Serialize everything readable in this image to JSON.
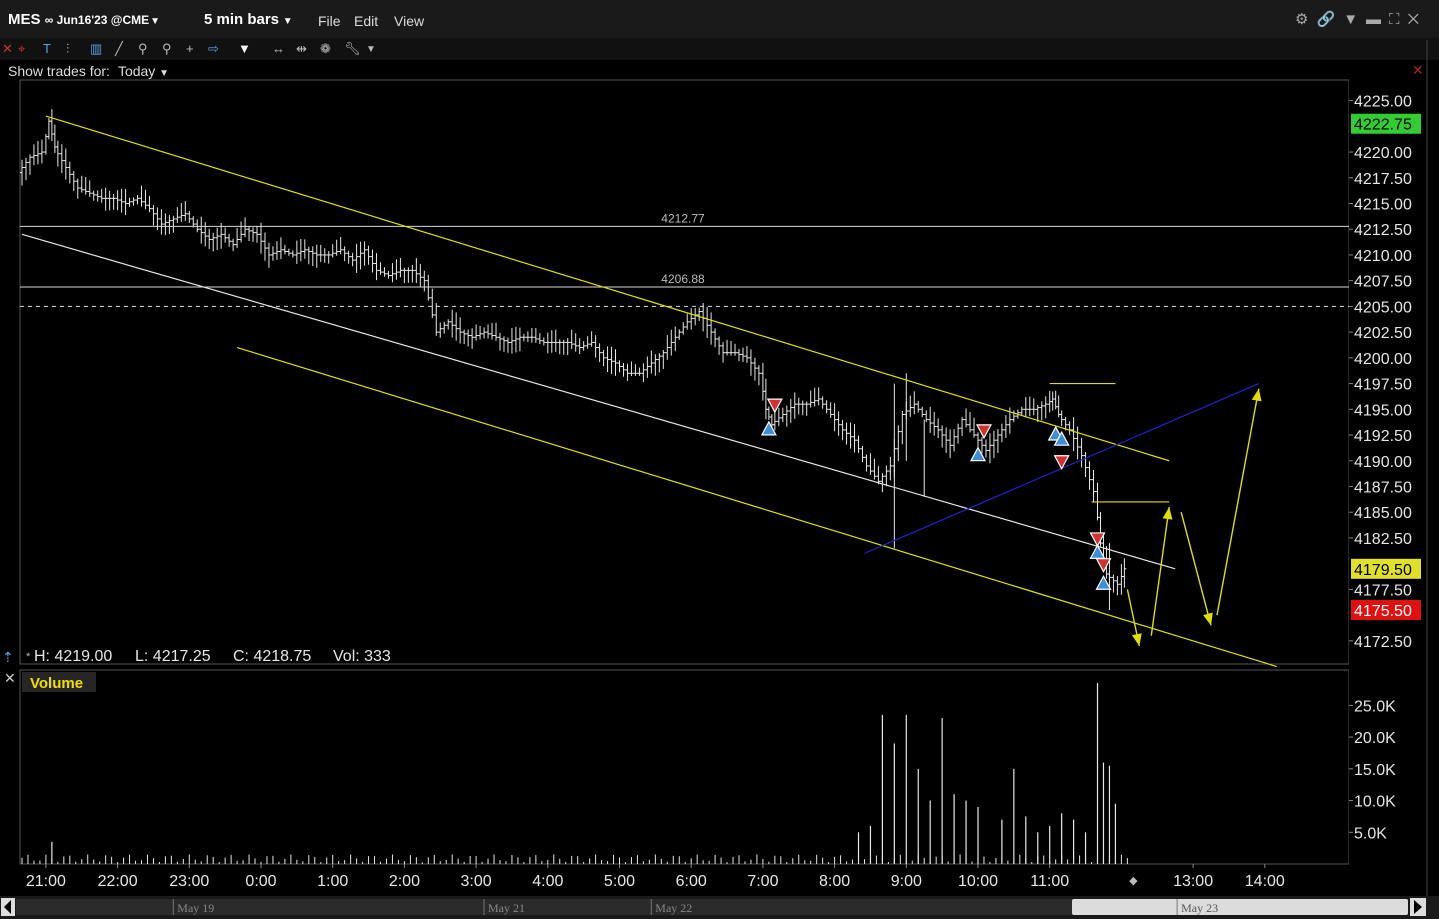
{
  "header": {
    "symbol": "MES",
    "contract": "∞ Jun16'23 @CME",
    "bar_size": "5 min bars",
    "menus": [
      "File",
      "Edit",
      "View"
    ]
  },
  "show_trades": {
    "label": "Show trades for:",
    "value": "Today"
  },
  "ohlc_readout": {
    "h": "H: 4219.00",
    "l": "L: 4217.25",
    "c": "C: 4218.75",
    "vol": "Vol: 333"
  },
  "volume_panel": {
    "label": "Volume"
  },
  "colors": {
    "up_arrow": "#3b8fd9",
    "down_arrow": "#d43030",
    "channel": "#e0e000",
    "mid_line": "#e6e6e6",
    "blue_line": "#2222cc",
    "last_price_bg": "#e0e02a",
    "high_badge_bg": "#33cc33",
    "low_badge_bg": "#e01010"
  },
  "chart_data": {
    "type": "ohlc",
    "price_axis": {
      "range": [
        4170.25,
        4227.0
      ],
      "ticks": [
        "4225.00",
        "4220.00",
        "4217.50",
        "4215.00",
        "4212.50",
        "4210.00",
        "4207.50",
        "4205.00",
        "4202.50",
        "4200.00",
        "4197.50",
        "4195.00",
        "4192.50",
        "4190.00",
        "4187.50",
        "4185.00",
        "4182.50",
        "4177.50",
        "4172.50"
      ]
    },
    "price_badges": [
      {
        "label": "4222.75",
        "value": 4222.75,
        "color": "#33cc33",
        "text_color": "#000"
      },
      {
        "label": "4179.50",
        "value": 4179.5,
        "color": "#e0e02a",
        "text_color": "#000"
      },
      {
        "label": "4175.50",
        "value": 4175.5,
        "color": "#e01010",
        "text_color": "#fff"
      }
    ],
    "h_levels": [
      {
        "value": 4212.77,
        "label": "4212.77",
        "style": "solid"
      },
      {
        "value": 4206.88,
        "label": "4206.88",
        "style": "solid"
      },
      {
        "value": 4205.0,
        "label": "",
        "style": "dashed"
      }
    ],
    "time_axis": {
      "start": "20:40",
      "end": "14:35",
      "ticks": [
        "21:00",
        "22:00",
        "23:00",
        "0:00",
        "1:00",
        "2:00",
        "3:00",
        "4:00",
        "5:00",
        "6:00",
        "7:00",
        "8:00",
        "9:00",
        "10:00",
        "11:00",
        "13:00",
        "14:00"
      ],
      "dates": [
        {
          "label": "May 19",
          "time": "23:00"
        },
        {
          "label": "May 21",
          "time": "3:20"
        },
        {
          "label": "May 22",
          "time": "5:40"
        },
        {
          "label": "May 23",
          "time": "13:00"
        }
      ]
    },
    "bar_points": [
      [
        "20:40",
        4218.0
      ],
      [
        "20:50",
        4219.5
      ],
      [
        "21:00",
        4220.0
      ],
      [
        "21:05",
        4223.0
      ],
      [
        "21:10",
        4220.5
      ],
      [
        "21:20",
        4218.5
      ],
      [
        "21:30",
        4216.5
      ],
      [
        "21:40",
        4216.0
      ],
      [
        "21:50",
        4215.5
      ],
      [
        "22:00",
        4215.5
      ],
      [
        "22:10",
        4215.0
      ],
      [
        "22:20",
        4215.5
      ],
      [
        "22:30",
        4214.5
      ],
      [
        "22:40",
        4213.0
      ],
      [
        "22:50",
        4213.5
      ],
      [
        "23:00",
        4214.0
      ],
      [
        "23:10",
        4212.5
      ],
      [
        "23:20",
        4211.5
      ],
      [
        "23:30",
        4212.0
      ],
      [
        "23:40",
        4211.0
      ],
      [
        "23:50",
        4212.5
      ],
      [
        "0:00",
        4212.0
      ],
      [
        "0:10",
        4210.0
      ],
      [
        "0:20",
        4210.5
      ],
      [
        "0:30",
        4210.0
      ],
      [
        "0:40",
        4210.5
      ],
      [
        "0:50",
        4210.0
      ],
      [
        "1:00",
        4210.0
      ],
      [
        "1:10",
        4210.5
      ],
      [
        "1:20",
        4209.5
      ],
      [
        "1:30",
        4210.5
      ],
      [
        "1:40",
        4208.5
      ],
      [
        "1:50",
        4208.0
      ],
      [
        "2:00",
        4208.5
      ],
      [
        "2:10",
        4208.5
      ],
      [
        "2:20",
        4207.5
      ],
      [
        "2:30",
        4202.5
      ],
      [
        "2:40",
        4203.5
      ],
      [
        "2:50",
        4202.5
      ],
      [
        "3:00",
        4202.0
      ],
      [
        "3:10",
        4202.5
      ],
      [
        "3:20",
        4202.0
      ],
      [
        "3:30",
        4201.5
      ],
      [
        "3:40",
        4202.0
      ],
      [
        "3:50",
        4202.0
      ],
      [
        "4:00",
        4201.5
      ],
      [
        "4:10",
        4201.5
      ],
      [
        "4:20",
        4201.5
      ],
      [
        "4:30",
        4201.0
      ],
      [
        "4:40",
        4201.5
      ],
      [
        "4:50",
        4200.0
      ],
      [
        "5:00",
        4199.5
      ],
      [
        "5:10",
        4198.5
      ],
      [
        "5:20",
        4198.5
      ],
      [
        "5:30",
        4199.5
      ],
      [
        "5:40",
        4200.5
      ],
      [
        "5:50",
        4202.0
      ],
      [
        "6:00",
        4203.5
      ],
      [
        "6:10",
        4204.5
      ],
      [
        "6:20",
        4202.5
      ],
      [
        "6:30",
        4200.5
      ],
      [
        "6:40",
        4200.5
      ],
      [
        "6:50",
        4200.0
      ],
      [
        "7:00",
        4198.5
      ],
      [
        "7:05",
        4195.0
      ],
      [
        "7:10",
        4193.5
      ],
      [
        "7:20",
        4194.5
      ],
      [
        "7:30",
        4195.5
      ],
      [
        "7:40",
        4195.5
      ],
      [
        "7:50",
        4196.0
      ],
      [
        "8:00",
        4194.5
      ],
      [
        "8:10",
        4193.0
      ],
      [
        "8:20",
        4192.0
      ],
      [
        "8:30",
        4189.5
      ],
      [
        "8:40",
        4188.0
      ],
      [
        "8:50",
        4189.5
      ],
      [
        "9:00",
        4194.5
      ],
      [
        "9:10",
        4195.5
      ],
      [
        "9:20",
        4194.0
      ],
      [
        "9:30",
        4193.0
      ],
      [
        "9:40",
        4191.5
      ],
      [
        "9:50",
        4194.0
      ],
      [
        "10:00",
        4192.5
      ],
      [
        "10:10",
        4191.0
      ],
      [
        "10:20",
        4192.5
      ],
      [
        "10:30",
        4194.0
      ],
      [
        "10:40",
        4195.0
      ],
      [
        "10:50",
        4195.0
      ],
      [
        "11:00",
        4195.5
      ],
      [
        "11:05",
        4196.0
      ],
      [
        "11:10",
        4194.5
      ],
      [
        "11:20",
        4193.0
      ],
      [
        "11:30",
        4190.5
      ],
      [
        "11:40",
        4187.0
      ],
      [
        "11:45",
        4182.0
      ],
      [
        "11:50",
        4179.0
      ],
      [
        "12:00",
        4178.0
      ],
      [
        "12:05",
        4179.5
      ]
    ],
    "trade_markers": [
      {
        "side": "sell",
        "time": "7:10",
        "price": 4195.5
      },
      {
        "side": "buy",
        "time": "7:05",
        "price": 4193.0
      },
      {
        "side": "buy",
        "time": "10:00",
        "price": 4190.5
      },
      {
        "side": "sell",
        "time": "10:05",
        "price": 4193.0
      },
      {
        "side": "buy",
        "time": "11:05",
        "price": 4192.5
      },
      {
        "side": "buy",
        "time": "11:10",
        "price": 4192.0
      },
      {
        "side": "sell",
        "time": "11:10",
        "price": 4190.0
      },
      {
        "side": "sell",
        "time": "11:40",
        "price": 4182.5
      },
      {
        "side": "buy",
        "time": "11:40",
        "price": 4181.0
      },
      {
        "side": "sell",
        "time": "11:45",
        "price": 4180.0
      },
      {
        "side": "buy",
        "time": "11:45",
        "price": 4178.0
      }
    ],
    "drawn_lines": [
      {
        "color": "yellow",
        "from": [
          "21:00",
          4223.5
        ],
        "to": [
          "12:40",
          4190.0
        ]
      },
      {
        "color": "yellow",
        "from": [
          "23:40",
          4201.0
        ],
        "to": [
          "14:10",
          4170.0
        ]
      },
      {
        "color": "white",
        "from": [
          "20:40",
          4212.0
        ],
        "to": [
          "12:45",
          4179.5
        ]
      },
      {
        "color": "blue",
        "from": [
          "8:25",
          4181.0
        ],
        "to": [
          "13:55",
          4197.5
        ]
      },
      {
        "color": "yellow",
        "from": [
          "11:00",
          4197.5
        ],
        "to": [
          "11:55",
          4197.5
        ]
      },
      {
        "color": "yellow",
        "from": [
          "11:35",
          4186.0
        ],
        "to": [
          "12:40",
          4186.0
        ]
      }
    ],
    "projection_arrows": [
      {
        "from": [
          "12:05",
          4177.5
        ],
        "to": [
          "12:15",
          4172.0
        ]
      },
      {
        "from": [
          "12:25",
          4173.0
        ],
        "to": [
          "12:40",
          4185.5
        ]
      },
      {
        "from": [
          "12:50",
          4185.0
        ],
        "to": [
          "13:15",
          4174.0
        ]
      },
      {
        "from": [
          "13:20",
          4175.0
        ],
        "to": [
          "13:55",
          4197.0
        ]
      }
    ],
    "volume": {
      "ticks": [
        "25.0K",
        "20.0K",
        "15.0K",
        "10.0K",
        "5.0K"
      ],
      "max": 29000,
      "bars": [
        [
          "21:05",
          3500
        ],
        [
          "8:20",
          5000
        ],
        [
          "8:30",
          6000
        ],
        [
          "8:40",
          23500
        ],
        [
          "8:50",
          19000
        ],
        [
          "9:00",
          23500
        ],
        [
          "9:10",
          15000
        ],
        [
          "9:20",
          10000
        ],
        [
          "9:30",
          23000
        ],
        [
          "9:40",
          11000
        ],
        [
          "9:50",
          10000
        ],
        [
          "10:00",
          9000
        ],
        [
          "10:20",
          7000
        ],
        [
          "10:30",
          15000
        ],
        [
          "10:40",
          7500
        ],
        [
          "10:50",
          5000
        ],
        [
          "11:00",
          6000
        ],
        [
          "11:10",
          8000
        ],
        [
          "11:20",
          7000
        ],
        [
          "11:30",
          5000
        ],
        [
          "11:40",
          28500
        ],
        [
          "11:45",
          16000
        ],
        [
          "11:50",
          15500
        ],
        [
          "11:55",
          9500
        ]
      ]
    }
  }
}
